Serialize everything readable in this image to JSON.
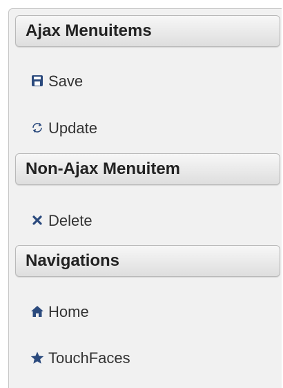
{
  "menu": {
    "groups": [
      {
        "header": "Ajax Menuitems",
        "items": [
          {
            "label": "Save",
            "icon": "save-icon"
          },
          {
            "label": "Update",
            "icon": "refresh-icon"
          }
        ]
      },
      {
        "header": "Non-Ajax Menuitem",
        "items": [
          {
            "label": "Delete",
            "icon": "close-icon"
          }
        ]
      },
      {
        "header": "Navigations",
        "items": [
          {
            "label": "Home",
            "icon": "home-icon"
          },
          {
            "label": "TouchFaces",
            "icon": "star-icon"
          }
        ]
      }
    ]
  },
  "colors": {
    "icon": "#2b4a7d",
    "text": "#333333",
    "header_text": "#222222",
    "panel_bg": "#f1f1f1"
  }
}
